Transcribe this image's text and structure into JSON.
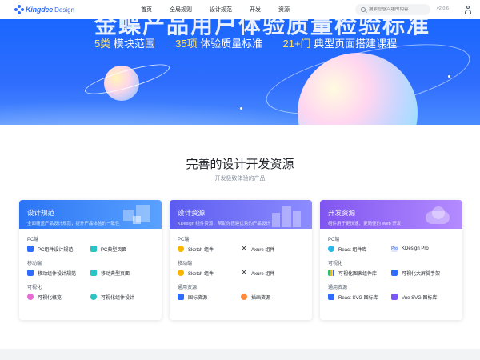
{
  "nav": {
    "logo_text": "Kingdee",
    "logo_sub": "Design",
    "menu": [
      "首页",
      "全局规则",
      "设计规范",
      "开发",
      "资源"
    ],
    "search_placeholder": "搜索您感兴趣的内容",
    "version": "v2.0.6"
  },
  "hero": {
    "title": "金蝶产品用户体验质量检验标准",
    "stats": [
      {
        "num": "5类",
        "text": "模块范围"
      },
      {
        "num": "35项",
        "text": "体验质量标准"
      },
      {
        "num": "21+门",
        "text": "典型页面搭建课程"
      }
    ]
  },
  "section": {
    "title": "完善的设计开发资源",
    "subtitle": "开发极致体验的产品"
  },
  "cards": [
    {
      "title": "设计规范",
      "desc": "全面覆盖产品设计规范，提升产品体验的一致性",
      "groups": [
        {
          "label": "PC端",
          "items": [
            {
              "icon": "doc-icon",
              "label": "PC组件设计规范"
            },
            {
              "icon": "page-icon",
              "label": "PC典型页面"
            }
          ]
        },
        {
          "label": "移动端",
          "items": [
            {
              "icon": "doc-icon",
              "label": "移动组件设计规范"
            },
            {
              "icon": "page-icon",
              "label": "移动典型页面"
            }
          ]
        },
        {
          "label": "可视化",
          "items": [
            {
              "icon": "chart-icon",
              "label": "可视化概览"
            },
            {
              "icon": "palette-icon",
              "label": "可视化组件设计"
            }
          ]
        }
      ]
    },
    {
      "title": "设计资源",
      "desc": "KDesign 组件资源，帮助你搭建优秀的产品设计",
      "groups": [
        {
          "label": "PC端",
          "items": [
            {
              "icon": "sketch-icon",
              "label": "Sketch 组件"
            },
            {
              "icon": "axure-icon",
              "label": "Axure 组件"
            }
          ]
        },
        {
          "label": "移动端",
          "items": [
            {
              "icon": "sketch-icon",
              "label": "Sketch 组件"
            },
            {
              "icon": "axure-icon",
              "label": "Axure 组件"
            }
          ]
        },
        {
          "label": "通用资源",
          "items": [
            {
              "icon": "image-icon",
              "label": "图标资源"
            },
            {
              "icon": "illustration-icon",
              "label": "插画资源"
            }
          ]
        }
      ]
    },
    {
      "title": "开发资源",
      "desc": "组件用于更快速、更简便的 Web 开发",
      "groups": [
        {
          "label": "PC端",
          "items": [
            {
              "icon": "react-icon",
              "label": "React 组件库"
            },
            {
              "icon": "pro-icon",
              "label": "KDesign Pro"
            }
          ]
        },
        {
          "label": "可视化",
          "items": [
            {
              "icon": "bar-chart-icon",
              "label": "可视化图表组件库"
            },
            {
              "icon": "dashboard-icon",
              "label": "可视化大屏脚手架"
            }
          ]
        },
        {
          "label": "通用资源",
          "items": [
            {
              "icon": "svg-icon",
              "label": "React SVG 图标库"
            },
            {
              "icon": "vue-icon",
              "label": "Vue SVG 图标库"
            }
          ]
        }
      ]
    }
  ],
  "colors": {
    "accent": "#2f6bff",
    "card1_head": "#2e7cf6",
    "card2_head": "#6a64f2",
    "card3_head": "#8b5cf6"
  }
}
